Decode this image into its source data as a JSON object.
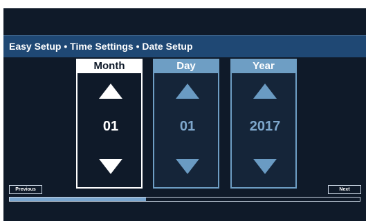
{
  "header": {
    "title": "Easy Setup • Time Settings • Date Setup"
  },
  "columns": [
    {
      "label": "Month",
      "value": "01",
      "active": true
    },
    {
      "label": "Day",
      "value": "01",
      "active": false
    },
    {
      "label": "Year",
      "value": "2017",
      "active": false
    }
  ],
  "navigation": {
    "previous_label": "Previous",
    "next_label": "Next"
  },
  "progress": {
    "fraction": 0.39
  },
  "icons": {
    "up": "triangle-up-icon",
    "down": "triangle-down-icon"
  },
  "colors": {
    "background": "#0f1a29",
    "title_bar": "#1f4874",
    "active": "#ffffff",
    "inactive": "#6e9ec4",
    "progress_fill": "#7aa6cf"
  }
}
